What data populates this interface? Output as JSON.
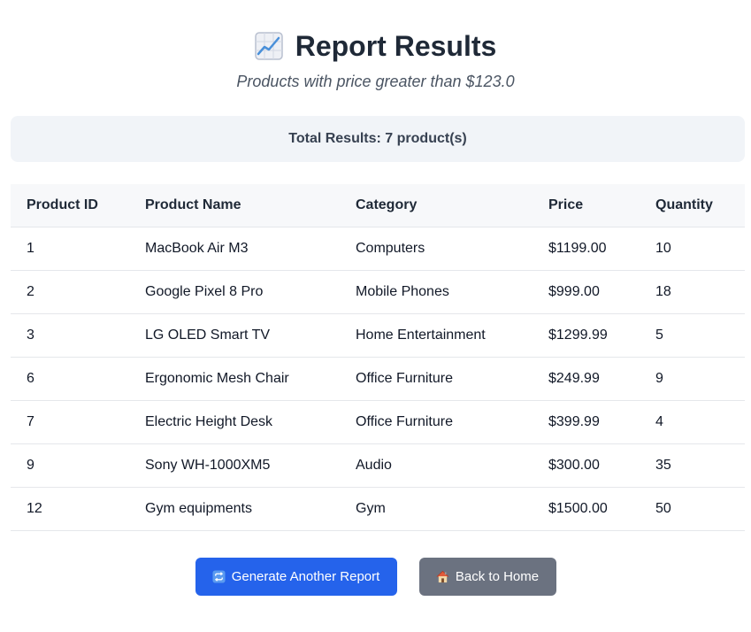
{
  "header": {
    "icon": "chart-increasing-icon",
    "title": "Report Results",
    "subtitle": "Products with price greater than $123.0"
  },
  "summary": {
    "text": "Total Results: 7 product(s)"
  },
  "table": {
    "columns": [
      "Product ID",
      "Product Name",
      "Category",
      "Price",
      "Quantity"
    ],
    "rows": [
      [
        "1",
        "MacBook Air M3",
        "Computers",
        "$1199.00",
        "10"
      ],
      [
        "2",
        "Google Pixel 8 Pro",
        "Mobile Phones",
        "$999.00",
        "18"
      ],
      [
        "3",
        "LG OLED Smart TV",
        "Home Entertainment",
        "$1299.99",
        "5"
      ],
      [
        "6",
        "Ergonomic Mesh Chair",
        "Office Furniture",
        "$249.99",
        "9"
      ],
      [
        "7",
        "Electric Height Desk",
        "Office Furniture",
        "$399.99",
        "4"
      ],
      [
        "9",
        "Sony WH-1000XM5",
        "Audio",
        "$300.00",
        "35"
      ],
      [
        "12",
        "Gym equipments",
        "Gym",
        "$1500.00",
        "50"
      ]
    ]
  },
  "actions": {
    "generate_label": "Generate Another Report",
    "generate_icon": "repeat-icon",
    "home_label": "Back to Home",
    "home_icon": "house-icon"
  },
  "colors": {
    "primary_button": "#2563eb",
    "secondary_button": "#6b7280",
    "summary_background": "#f1f4f8"
  }
}
